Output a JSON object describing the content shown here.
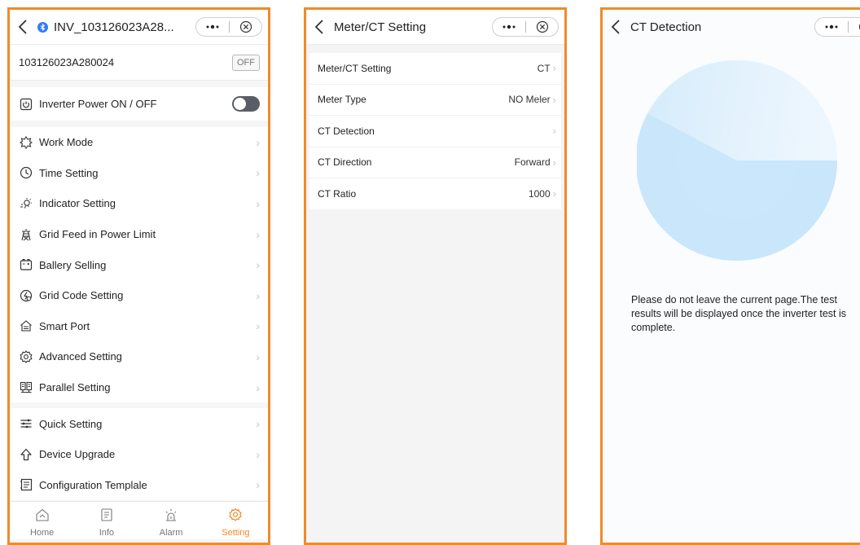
{
  "panel1": {
    "title": "INV_103126023A28...",
    "serial": "103126023A280024",
    "off_badge": "OFF",
    "power_label": "Inverter Power ON / OFF",
    "menu": [
      {
        "label": "Work Mode",
        "icon": "sun-icon"
      },
      {
        "label": "Time Setting",
        "icon": "clock-icon"
      },
      {
        "label": "Indicator Setting",
        "icon": "bulb-icon"
      },
      {
        "label": "Grid Feed in Power Limit",
        "icon": "tower-icon"
      },
      {
        "label": "Ballery Selling",
        "icon": "battery-icon"
      },
      {
        "label": "Grid Code Setting",
        "icon": "gridcode-icon"
      },
      {
        "label": "Smart Port",
        "icon": "home-port-icon"
      },
      {
        "label": "Advanced Setting",
        "icon": "gear-icon"
      },
      {
        "label": "Parallel Setting",
        "icon": "parallel-icon"
      }
    ],
    "menu2": [
      {
        "label": "Quick Setting",
        "icon": "sliders-icon"
      },
      {
        "label": "Device Upgrade",
        "icon": "upgrade-icon"
      },
      {
        "label": "Configuration Templale",
        "icon": "template-icon"
      }
    ],
    "tabs": [
      {
        "label": "Home",
        "icon": "home-icon"
      },
      {
        "label": "Info",
        "icon": "info-icon"
      },
      {
        "label": "Alarm",
        "icon": "alarm-icon"
      },
      {
        "label": "Setting",
        "icon": "setting-icon"
      }
    ]
  },
  "panel2": {
    "title": "Meter/CT Setting",
    "items": [
      {
        "label": "Meter/CT Setting",
        "value": "CT"
      },
      {
        "label": "Meter Type",
        "value": "NO Meler"
      },
      {
        "label": "CT Detection",
        "value": ""
      },
      {
        "label": "CT Direction",
        "value": "Forward"
      },
      {
        "label": "CT Ratio",
        "value": "1000"
      }
    ]
  },
  "panel3": {
    "title": "CT Detection",
    "message": "Please do not leave the current page.The test results will be displayed once the inverter test is complete."
  },
  "colors": {
    "accent": "#f08a2a",
    "toggle_off": "#595e66",
    "bluetooth": "#2f7df6",
    "radar": "#bfe2fb"
  }
}
